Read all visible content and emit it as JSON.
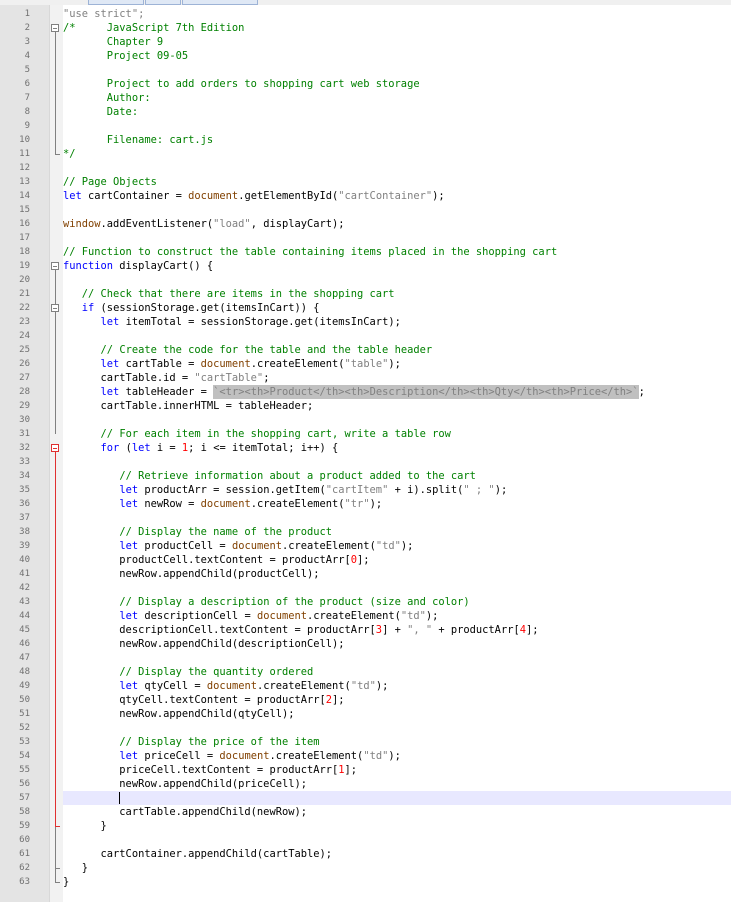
{
  "editor": {
    "file_tabs": [
      "",
      "",
      ""
    ],
    "caret_line": 57,
    "selected_line": 28,
    "lines": [
      {
        "n": "1",
        "t": [
          [
            "\"use strict\";",
            "st"
          ]
        ]
      },
      {
        "n": "2",
        "t": [
          [
            "/*     JavaScript 7th Edition",
            "cm"
          ]
        ]
      },
      {
        "n": "3",
        "t": [
          [
            "       Chapter 9",
            "cm"
          ]
        ]
      },
      {
        "n": "4",
        "t": [
          [
            "       Project 09-05",
            "cm"
          ]
        ]
      },
      {
        "n": "5",
        "t": []
      },
      {
        "n": "6",
        "t": [
          [
            "       Project to add orders to shopping cart web storage",
            "cm"
          ]
        ]
      },
      {
        "n": "7",
        "t": [
          [
            "       Author:",
            "cm"
          ]
        ]
      },
      {
        "n": "8",
        "t": [
          [
            "       Date:",
            "cm"
          ]
        ]
      },
      {
        "n": "9",
        "t": []
      },
      {
        "n": "10",
        "t": [
          [
            "       Filename: cart.js",
            "cm"
          ]
        ]
      },
      {
        "n": "11",
        "t": [
          [
            "*/",
            "cm"
          ]
        ]
      },
      {
        "n": "12",
        "t": []
      },
      {
        "n": "13",
        "t": [
          [
            "// Page Objects",
            "cm"
          ]
        ]
      },
      {
        "n": "14",
        "t": [
          [
            "let",
            "kw"
          ],
          [
            " cartContainer = ",
            ""
          ],
          [
            "document",
            "dc"
          ],
          [
            ".getElementById(",
            ""
          ],
          [
            "\"cartContainer\"",
            "st"
          ],
          [
            ");",
            ""
          ]
        ]
      },
      {
        "n": "15",
        "t": []
      },
      {
        "n": "16",
        "t": [
          [
            "window",
            "dc"
          ],
          [
            ".addEventListener(",
            ""
          ],
          [
            "\"load\"",
            "st"
          ],
          [
            ", displayCart);",
            ""
          ]
        ]
      },
      {
        "n": "17",
        "t": []
      },
      {
        "n": "18",
        "t": [
          [
            "// Function to construct the table containing items placed in the shopping cart",
            "cm"
          ]
        ]
      },
      {
        "n": "19",
        "t": [
          [
            "function",
            "kw"
          ],
          [
            " displayCart() {",
            ""
          ]
        ]
      },
      {
        "n": "20",
        "t": []
      },
      {
        "n": "21",
        "t": [
          [
            "   ",
            ""
          ],
          [
            "// Check that there are items in the shopping cart",
            "cm"
          ]
        ]
      },
      {
        "n": "22",
        "t": [
          [
            "   ",
            ""
          ],
          [
            "if",
            "kw"
          ],
          [
            " (sessionStorage.get(itemsInCart)) {",
            ""
          ]
        ]
      },
      {
        "n": "23",
        "t": [
          [
            "      ",
            ""
          ],
          [
            "let",
            "kw"
          ],
          [
            " itemTotal = sessionStorage.get(itemsInCart);",
            ""
          ]
        ]
      },
      {
        "n": "24",
        "t": []
      },
      {
        "n": "25",
        "t": [
          [
            "      ",
            ""
          ],
          [
            "// Create the code for the table and the table header",
            "cm"
          ]
        ]
      },
      {
        "n": "26",
        "t": [
          [
            "      ",
            ""
          ],
          [
            "let",
            "kw"
          ],
          [
            " cartTable = ",
            ""
          ],
          [
            "document",
            "dc"
          ],
          [
            ".createElement(",
            ""
          ],
          [
            "\"table\"",
            "st"
          ],
          [
            ");",
            ""
          ]
        ]
      },
      {
        "n": "27",
        "t": [
          [
            "      cartTable.id = ",
            ""
          ],
          [
            "\"cartTable\"",
            "st"
          ],
          [
            ";",
            ""
          ]
        ]
      },
      {
        "n": "28",
        "t": [
          [
            "      ",
            ""
          ],
          [
            "let",
            "kw"
          ],
          [
            " tableHeader = ",
            ""
          ],
          [
            "`<tr><th>Product</th><th>Description</th><th>Qty</th><th>Price</th>`",
            "st"
          ],
          [
            ";",
            ""
          ]
        ]
      },
      {
        "n": "29",
        "t": [
          [
            "      cartTable.innerHTML = tableHeader;",
            ""
          ]
        ]
      },
      {
        "n": "30",
        "t": []
      },
      {
        "n": "31",
        "t": [
          [
            "      ",
            ""
          ],
          [
            "// For each item in the shopping cart, write a table row",
            "cm"
          ]
        ]
      },
      {
        "n": "32",
        "t": [
          [
            "      ",
            ""
          ],
          [
            "for",
            "kw"
          ],
          [
            " (",
            ""
          ],
          [
            "let",
            "kw"
          ],
          [
            " i = ",
            ""
          ],
          [
            "1",
            "nm"
          ],
          [
            "; i <= itemTotal; i++) {",
            ""
          ]
        ]
      },
      {
        "n": "33",
        "t": []
      },
      {
        "n": "34",
        "t": [
          [
            "         ",
            ""
          ],
          [
            "// Retrieve information about a product added to the cart",
            "cm"
          ]
        ]
      },
      {
        "n": "35",
        "t": [
          [
            "         ",
            ""
          ],
          [
            "let",
            "kw"
          ],
          [
            " productArr = session.getItem(",
            ""
          ],
          [
            "\"cartItem\"",
            "st"
          ],
          [
            " + i).split(",
            ""
          ],
          [
            "\" ; \"",
            "st"
          ],
          [
            ");",
            ""
          ]
        ]
      },
      {
        "n": "36",
        "t": [
          [
            "         ",
            ""
          ],
          [
            "let",
            "kw"
          ],
          [
            " newRow = ",
            ""
          ],
          [
            "document",
            "dc"
          ],
          [
            ".createElement(",
            ""
          ],
          [
            "\"tr\"",
            "st"
          ],
          [
            ");",
            ""
          ]
        ]
      },
      {
        "n": "37",
        "t": []
      },
      {
        "n": "38",
        "t": [
          [
            "         ",
            ""
          ],
          [
            "// Display the name of the product",
            "cm"
          ]
        ]
      },
      {
        "n": "39",
        "t": [
          [
            "         ",
            ""
          ],
          [
            "let",
            "kw"
          ],
          [
            " productCell = ",
            ""
          ],
          [
            "document",
            "dc"
          ],
          [
            ".createElement(",
            ""
          ],
          [
            "\"td\"",
            "st"
          ],
          [
            ");",
            ""
          ]
        ]
      },
      {
        "n": "40",
        "t": [
          [
            "         productCell.textContent = productArr[",
            ""
          ],
          [
            "0",
            "nm"
          ],
          [
            "];",
            ""
          ]
        ]
      },
      {
        "n": "41",
        "t": [
          [
            "         newRow.appendChild(productCell);",
            ""
          ]
        ]
      },
      {
        "n": "42",
        "t": []
      },
      {
        "n": "43",
        "t": [
          [
            "         ",
            ""
          ],
          [
            "// Display a description of the product (size and color)",
            "cm"
          ]
        ]
      },
      {
        "n": "44",
        "t": [
          [
            "         ",
            ""
          ],
          [
            "let",
            "kw"
          ],
          [
            " descriptionCell = ",
            ""
          ],
          [
            "document",
            "dc"
          ],
          [
            ".createElement(",
            ""
          ],
          [
            "\"td\"",
            "st"
          ],
          [
            ");",
            ""
          ]
        ]
      },
      {
        "n": "45",
        "t": [
          [
            "         descriptionCell.textContent = productArr[",
            ""
          ],
          [
            "3",
            "nm"
          ],
          [
            "] + ",
            ""
          ],
          [
            "\", \"",
            "st"
          ],
          [
            " + productArr[",
            ""
          ],
          [
            "4",
            "nm"
          ],
          [
            "];",
            ""
          ]
        ]
      },
      {
        "n": "46",
        "t": [
          [
            "         newRow.appendChild(descriptionCell);",
            ""
          ]
        ]
      },
      {
        "n": "47",
        "t": []
      },
      {
        "n": "48",
        "t": [
          [
            "         ",
            ""
          ],
          [
            "// Display the quantity ordered",
            "cm"
          ]
        ]
      },
      {
        "n": "49",
        "t": [
          [
            "         ",
            ""
          ],
          [
            "let",
            "kw"
          ],
          [
            " qtyCell = ",
            ""
          ],
          [
            "document",
            "dc"
          ],
          [
            ".createElement(",
            ""
          ],
          [
            "\"td\"",
            "st"
          ],
          [
            ");",
            ""
          ]
        ]
      },
      {
        "n": "50",
        "t": [
          [
            "         qtyCell.textContent = productArr[",
            ""
          ],
          [
            "2",
            "nm"
          ],
          [
            "];",
            ""
          ]
        ]
      },
      {
        "n": "51",
        "t": [
          [
            "         newRow.appendChild(qtyCell);",
            ""
          ]
        ]
      },
      {
        "n": "52",
        "t": []
      },
      {
        "n": "53",
        "t": [
          [
            "         ",
            ""
          ],
          [
            "// Display the price of the item",
            "cm"
          ]
        ]
      },
      {
        "n": "54",
        "t": [
          [
            "         ",
            ""
          ],
          [
            "let",
            "kw"
          ],
          [
            " priceCell = ",
            ""
          ],
          [
            "document",
            "dc"
          ],
          [
            ".createElement(",
            ""
          ],
          [
            "\"td\"",
            "st"
          ],
          [
            ");",
            ""
          ]
        ]
      },
      {
        "n": "55",
        "t": [
          [
            "         priceCell.textContent = productArr[",
            ""
          ],
          [
            "1",
            "nm"
          ],
          [
            "];",
            ""
          ]
        ]
      },
      {
        "n": "56",
        "t": [
          [
            "         newRow.appendChild(priceCell);",
            ""
          ]
        ]
      },
      {
        "n": "57",
        "t": []
      },
      {
        "n": "58",
        "t": [
          [
            "         cartTable.appendChild(newRow);",
            ""
          ]
        ]
      },
      {
        "n": "59",
        "t": [
          [
            "      }",
            ""
          ]
        ]
      },
      {
        "n": "60",
        "t": []
      },
      {
        "n": "61",
        "t": [
          [
            "      cartContainer.appendChild(cartTable);",
            ""
          ]
        ]
      },
      {
        "n": "62",
        "t": [
          [
            "   }",
            ""
          ]
        ]
      },
      {
        "n": "63",
        "t": [
          [
            "}",
            ""
          ]
        ]
      }
    ]
  },
  "colors": {
    "comment": "#008000",
    "keyword": "#0000ff",
    "string": "#808080",
    "document_object": "#804000",
    "number": "#ff0000",
    "caret_line_bg": "#e8e8ff",
    "selection_bg": "#c0c0c0",
    "fold_marker": "#808080",
    "fold_marker_changed": "#e03030"
  },
  "icons": {
    "fold_collapse": "minus-box-icon",
    "fold_end": "fold-corner-icon"
  }
}
